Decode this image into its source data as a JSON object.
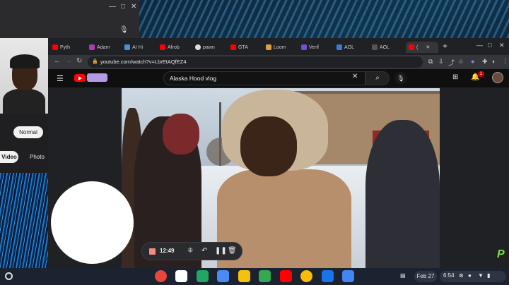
{
  "mini_window": {
    "minimize": "—",
    "maximize": "□",
    "close": "✕",
    "mic_icon": "microphone-icon"
  },
  "camera_app": {
    "mode_normal": "Normal",
    "mode_video": "Video",
    "mode_photo": "Photo"
  },
  "browser": {
    "tabs": [
      {
        "label": "Pyth",
        "icon_color": "#ff0000"
      },
      {
        "label": "Adam",
        "icon_color": "#b03ab0"
      },
      {
        "label": "AI Hi",
        "icon_color": "#4a90d9"
      },
      {
        "label": "Afrob",
        "icon_color": "#ff0000"
      },
      {
        "label": "pawn",
        "icon_color": "#dddddd"
      },
      {
        "label": "GTA",
        "icon_color": "#ff0000"
      },
      {
        "label": "Loom",
        "icon_color": "#d8a040"
      },
      {
        "label": "Verif",
        "icon_color": "#7a4ae0"
      },
      {
        "label": "AOL",
        "icon_color": "#3a7bd5"
      },
      {
        "label": "AOL",
        "icon_color": "#333333"
      },
      {
        "label": "(",
        "icon_color": "#ff0000"
      }
    ],
    "url": "youtube.com/watch?v=LbrEtAQfEZ4"
  },
  "youtube": {
    "search_query": "Alaska Hood vlog",
    "notification_count": "1"
  },
  "recording": {
    "time": "12:49"
  },
  "shelf": {
    "apps": [
      {
        "name": "chrome-app",
        "color": "#e8453c"
      },
      {
        "name": "gmail-app",
        "color": "#ffffff"
      },
      {
        "name": "sheets-app",
        "color": "#22a565"
      },
      {
        "name": "files-app",
        "color": "#4a8af4"
      },
      {
        "name": "drive-app",
        "color": "#f4c20d"
      },
      {
        "name": "play-store-app",
        "color": "#34a853"
      },
      {
        "name": "youtube-app",
        "color": "#ff0000"
      },
      {
        "name": "photos-app",
        "color": "#fbbc05"
      },
      {
        "name": "messages-app",
        "color": "#1a73e8"
      },
      {
        "name": "camera-app",
        "color": "#4285f4"
      }
    ],
    "date": "Feb 27",
    "time": "6:54"
  }
}
